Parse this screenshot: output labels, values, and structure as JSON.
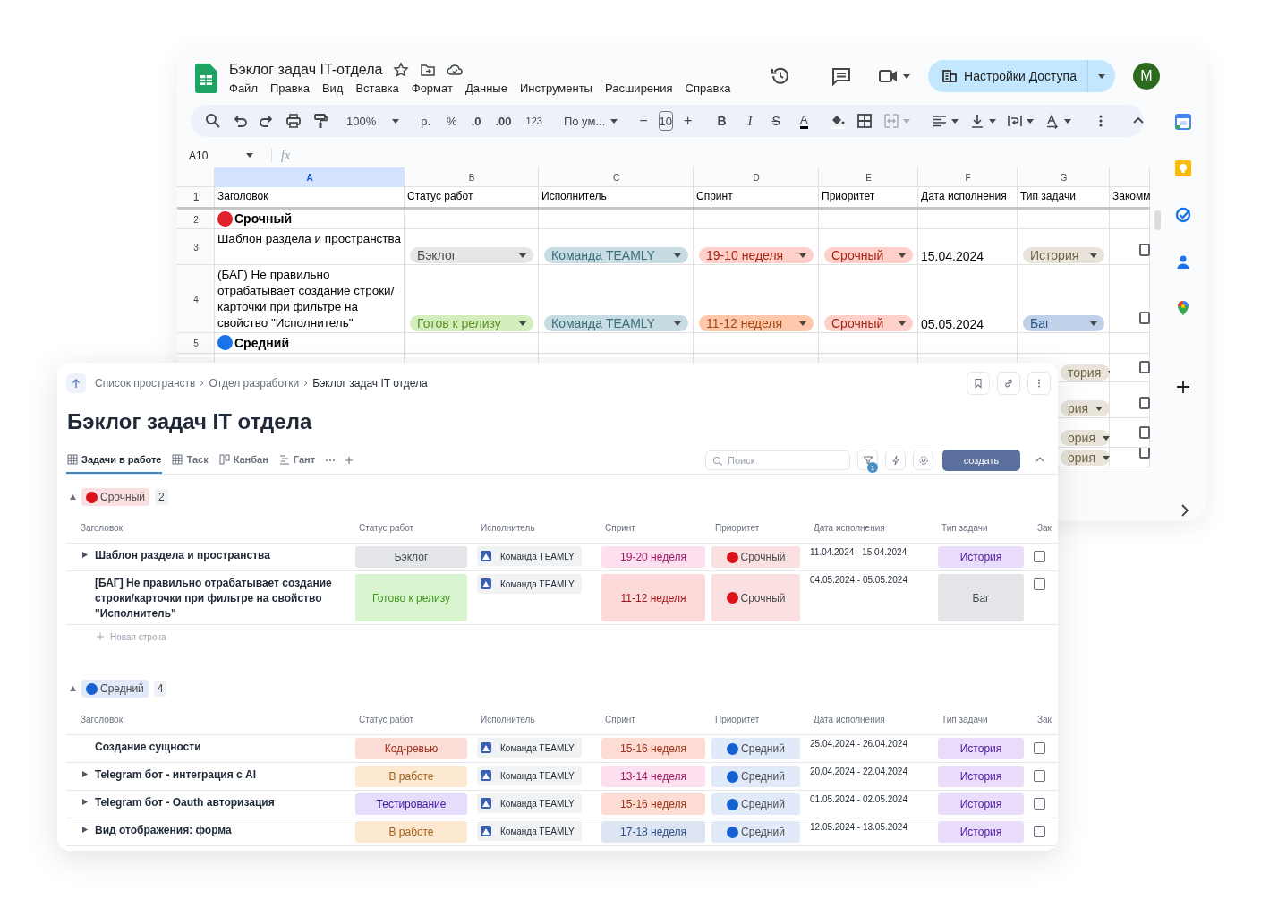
{
  "sheets": {
    "title": "Бэклог задач IT-отдела",
    "menu": [
      "Файл",
      "Правка",
      "Вид",
      "Вставка",
      "Формат",
      "Данные",
      "Инструменты",
      "Расширения",
      "Справка"
    ],
    "share_button": "Настройки Доступа",
    "avatar": "M",
    "toolbar": {
      "zoom": "100%",
      "currency": "р.",
      "percent": "%",
      "decrease_decimals": ".0",
      "increase_decimals": ".00",
      "number_format": "123",
      "font": "По ум...",
      "minus": "−",
      "font_size": "10",
      "plus": "+",
      "bold": "B",
      "italic": "I",
      "strike": "S",
      "text_color": "A"
    },
    "name_box": "A10",
    "formula_label": "fx",
    "columns": [
      {
        "label": "A",
        "selected": true
      },
      {
        "label": "B",
        "selected": false
      },
      {
        "label": "C",
        "selected": false
      },
      {
        "label": "D",
        "selected": false
      },
      {
        "label": "E",
        "selected": false
      },
      {
        "label": "F",
        "selected": false
      },
      {
        "label": "G",
        "selected": false
      }
    ],
    "header_row": {
      "number": "1",
      "cells": [
        "Заголовок",
        "Статус работ",
        "Исполнитель",
        "Спринт",
        "Приоритет",
        "Дата исполнения",
        "Тип задачи",
        "Закомм"
      ]
    },
    "rows": [
      {
        "number": "2",
        "kind": "group",
        "label": "Срочный",
        "color": "#e0202a"
      },
      {
        "number": "3",
        "kind": "task",
        "title": "Шаблон раздела и пространства",
        "status": {
          "text": "Бэклог",
          "color": "#e6e6e6"
        },
        "assignee": {
          "text": "Команда TEAMLY",
          "color": "#c6dce2"
        },
        "sprint": {
          "text": "19-10 неделя",
          "color": "#ffcfc9"
        },
        "priority": {
          "text": "Срочный",
          "color": "#ffcfc9"
        },
        "date": "15.04.2024",
        "type": {
          "text": "История",
          "color": "#e8e4da"
        },
        "checked": false
      },
      {
        "number": "4",
        "kind": "task",
        "title": "(БАГ) Не правильно отрабатывает создание строки/карточки при фильтре на свойство \"Исполнитель\"",
        "status": {
          "text": "Готов к релизу",
          "color": "#d4edbc"
        },
        "assignee": {
          "text": "Команда TEAMLY",
          "color": "#c6dce2"
        },
        "sprint": {
          "text": "11-12 неделя",
          "color": "#ffc8aa"
        },
        "priority": {
          "text": "Срочный",
          "color": "#ffcfc9"
        },
        "date": "05.05.2024",
        "type": {
          "text": "Баг",
          "color": "#bfd1e8"
        },
        "checked": false
      },
      {
        "number": "5",
        "kind": "group",
        "label": "Средний",
        "color": "#1a73e8"
      },
      {
        "kind": "partial",
        "type": {
          "text": "тория",
          "color": "#e8e4da"
        },
        "checked": false
      },
      {
        "kind": "partial",
        "type": {
          "text": "рия",
          "color": "#e8e4da"
        },
        "checked": false
      },
      {
        "kind": "partial",
        "type": {
          "text": "ория",
          "color": "#e8e4da"
        },
        "checked": false
      },
      {
        "kind": "partial",
        "type": {
          "text": "ория",
          "color": "#e8e4da"
        },
        "checked": false
      }
    ]
  },
  "teamly": {
    "breadcrumbs": [
      "Список пространств",
      "Отдел разработки",
      "Бэклог задач IT отдела"
    ],
    "title": "Бэклог задач IT отдела",
    "views": [
      {
        "label": "Задачи в работе",
        "kind": "table",
        "selected": true
      },
      {
        "label": "Таск",
        "kind": "table",
        "selected": false
      },
      {
        "label": "Канбан",
        "kind": "kanban",
        "selected": false
      },
      {
        "label": "Гант",
        "kind": "gantt",
        "selected": false
      }
    ],
    "search": {
      "placeholder": "Поиск"
    },
    "filter_count": "1",
    "create_button": "создать",
    "groups": [
      {
        "label": "Срочный",
        "color": "#d9141c",
        "count": "2",
        "expanded": true,
        "columns": [
          "Заголовок",
          "Статус работ",
          "Исполнитель",
          "Спринт",
          "Приоритет",
          "Дата исполнения",
          "Тип задачи",
          "Зак"
        ],
        "new_row": "Новая строка",
        "rows": [
          {
            "title": "Шаблон раздела и пространства",
            "expandable": true,
            "status": {
              "text": "Бэклог",
              "color": "#e3e5e8"
            },
            "assignee": "Команда TEAMLY",
            "sprint": {
              "text": "19-20 неделя",
              "color": "#fde0f0"
            },
            "priority": {
              "text": "Срочный",
              "color": "#d9141c"
            },
            "dates": "11.04.2024 - 15.04.2024",
            "type": {
              "text": "История",
              "color": "#e9ddfb"
            },
            "checked": false
          },
          {
            "title": "[БАГ] Не правильно отрабатывает создание строки/карточки при фильтре на свойство \"Исполнитель\"",
            "expandable": false,
            "status": {
              "text": "Готово к релизу",
              "color": "#d9f5d0"
            },
            "assignee": "Команда TEAMLY",
            "sprint": {
              "text": "11-12 неделя",
              "color": "#fddada"
            },
            "priority": {
              "text": "Срочный",
              "color": "#d9141c"
            },
            "dates": "04.05.2024 - 05.05.2024",
            "type": {
              "text": "Баг",
              "color": "#e3e5e8"
            },
            "checked": false
          }
        ]
      },
      {
        "label": "Средний",
        "color": "#1660d0",
        "count": "4",
        "expanded": true,
        "columns": [
          "Заголовок",
          "Статус работ",
          "Исполнитель",
          "Спринт",
          "Приоритет",
          "Дата исполнения",
          "Тип задачи",
          "Зак"
        ],
        "rows": [
          {
            "title": "Создание сущности",
            "expandable": false,
            "status": {
              "text": "Код-ревью",
              "color": "#fcdcd6"
            },
            "assignee": "Команда TEAMLY",
            "sprint": {
              "text": "15-16 неделя",
              "color": "#fddcd4"
            },
            "priority": {
              "text": "Средний",
              "color": "#1660d0"
            },
            "dates": "25.04.2024 - 26.04.2024",
            "type": {
              "text": "История",
              "color": "#e9ddfb"
            },
            "checked": false
          },
          {
            "title": "Telegram бот - интеграция с AI",
            "expandable": true,
            "status": {
              "text": "В работе",
              "color": "#fde9d2"
            },
            "assignee": "Команда TEAMLY",
            "sprint": {
              "text": "13-14 неделя",
              "color": "#fde0f0"
            },
            "priority": {
              "text": "Средний",
              "color": "#1660d0"
            },
            "dates": "20.04.2024 - 22.04.2024",
            "type": {
              "text": "История",
              "color": "#e9ddfb"
            },
            "checked": false
          },
          {
            "title": "Telegram бот - Oauth авторизация",
            "expandable": true,
            "status": {
              "text": "Тестирование",
              "color": "#e6dcfb"
            },
            "assignee": "Команда TEAMLY",
            "sprint": {
              "text": "15-16 неделя",
              "color": "#fddcd4"
            },
            "priority": {
              "text": "Средний",
              "color": "#1660d0"
            },
            "dates": "01.05.2024 - 02.05.2024",
            "type": {
              "text": "История",
              "color": "#e9ddfb"
            },
            "checked": false
          },
          {
            "title": "Вид отображения: форма",
            "expandable": true,
            "status": {
              "text": "В работе",
              "color": "#fde9d2"
            },
            "assignee": "Команда TEAMLY",
            "sprint": {
              "text": "17-18 неделя",
              "color": "#dde5f3"
            },
            "priority": {
              "text": "Средний",
              "color": "#1660d0"
            },
            "dates": "12.05.2024 - 13.05.2024",
            "type": {
              "text": "История",
              "color": "#e9ddfb"
            },
            "checked": false
          }
        ]
      }
    ]
  }
}
